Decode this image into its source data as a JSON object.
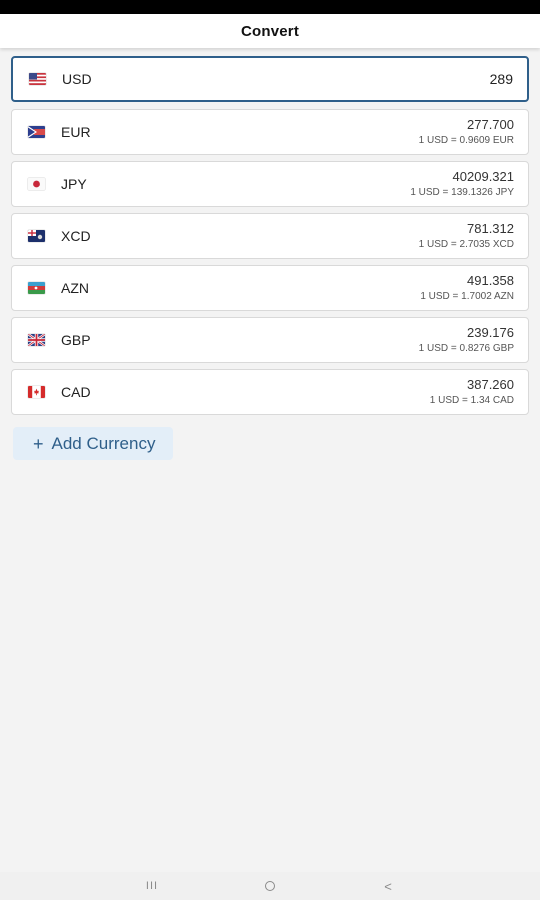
{
  "app_bar": {
    "title": "Convert"
  },
  "base": {
    "code": "USD",
    "amount": "289",
    "flag": "us-flag"
  },
  "currencies": [
    {
      "code": "EUR",
      "amount": "277.700",
      "rate": "1 USD = 0.9609 EUR",
      "flag": "eu-flag"
    },
    {
      "code": "JPY",
      "amount": "40209.321",
      "rate": "1 USD = 139.1326 JPY",
      "flag": "jp-flag"
    },
    {
      "code": "XCD",
      "amount": "781.312",
      "rate": "1 USD = 2.7035 XCD",
      "flag": "xcd-flag"
    },
    {
      "code": "AZN",
      "amount": "491.358",
      "rate": "1 USD = 1.7002 AZN",
      "flag": "az-flag"
    },
    {
      "code": "GBP",
      "amount": "239.176",
      "rate": "1 USD = 0.8276 GBP",
      "flag": "gb-flag"
    },
    {
      "code": "CAD",
      "amount": "387.260",
      "rate": "1 USD = 1.34 CAD",
      "flag": "ca-flag"
    }
  ],
  "add_button": {
    "label": "Add Currency",
    "icon": "plus-icon"
  },
  "nav": {
    "recents": "III",
    "back": "<"
  },
  "colors": {
    "accent": "#2f5f8a",
    "accent_light": "#e3eef8",
    "background": "#f3f3f3"
  }
}
